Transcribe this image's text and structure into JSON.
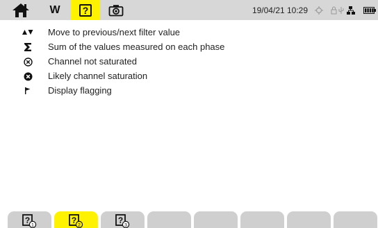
{
  "header": {
    "home_icon": "home-icon",
    "mode_label": "W",
    "help_label": "?",
    "camera_icon": "camera-icon",
    "datetime": "19/04/21 10:29",
    "status_icons": [
      "gps-icon",
      "lock-icon",
      "usb-icon",
      "network-icon",
      "battery-icon"
    ],
    "colors": {
      "bar": "#d7d7d7",
      "active": "#fff200"
    }
  },
  "legend": {
    "items": [
      {
        "icon": "up-down-arrows-icon",
        "label": "Move to previous/next filter value"
      },
      {
        "icon": "sigma-icon",
        "label": "Sum of the values measured on each phase"
      },
      {
        "icon": "circle-x-outline-icon",
        "label": "Channel not saturated"
      },
      {
        "icon": "circle-x-filled-icon",
        "label": "Likely channel saturation"
      },
      {
        "icon": "flag-icon",
        "label": "Display flagging"
      }
    ]
  },
  "bottom_tabs": {
    "active_index": 1,
    "items": [
      {
        "icon": "help-page-1-icon",
        "page": "1"
      },
      {
        "icon": "help-page-2-icon",
        "page": "2"
      },
      {
        "icon": "help-page-3-icon",
        "page": "3"
      },
      {
        "icon": "empty-tab"
      },
      {
        "icon": "empty-tab"
      },
      {
        "icon": "empty-tab"
      },
      {
        "icon": "empty-tab"
      },
      {
        "icon": "empty-tab"
      }
    ]
  }
}
